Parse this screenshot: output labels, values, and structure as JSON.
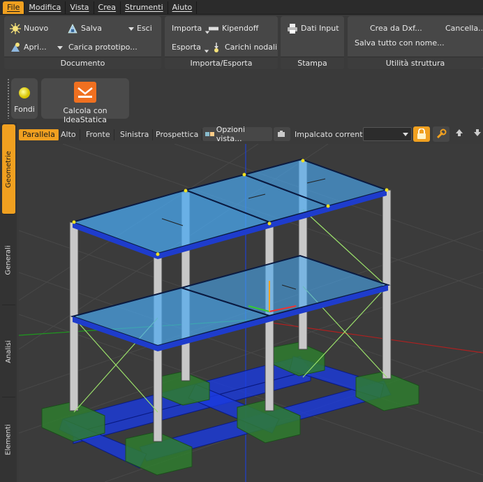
{
  "menu": [
    "File",
    "Modifica",
    "Vista",
    "Crea",
    "Strumenti",
    "Aiuto"
  ],
  "ribbon": {
    "documento": {
      "title": "Documento",
      "nuovo": "Nuovo",
      "salva": "Salva",
      "esci": "Esci",
      "apri": "Apri...",
      "carica": "Carica prototipo..."
    },
    "importa_esporta": {
      "title": "Importa/Esporta",
      "importa": "Importa",
      "kipendoff": "Kipendoff",
      "esporta": "Esporta",
      "carichi": "Carichi nodali"
    },
    "stampa": {
      "title": "Stampa",
      "dati_input": "Dati Input"
    },
    "utilita": {
      "title": "Utilità struttura",
      "crea_dxf": "Crea da Dxf...",
      "cancella": "Cancella...",
      "salva_tutto": "Salva tutto con nome..."
    }
  },
  "toolbar2": {
    "fondi": "Fondi",
    "calcola": "Calcola con IdeaStatica"
  },
  "sidebar_tabs": [
    "Geometrie",
    "Generali",
    "Analisi",
    "Elementi"
  ],
  "view_tabs": [
    "Parallela",
    "Alto",
    "Fronte",
    "Sinistra",
    "Prospettica"
  ],
  "view_options": "Opzioni vista...",
  "impalcato_label": "Impalcato corrente:",
  "impalcato_value": "",
  "colors": {
    "accent": "#f0a020",
    "slab": "#4aa8f0",
    "beam": "#1e3ccc",
    "foundation": "#2f7d2f",
    "brace": "#9adf6a"
  }
}
